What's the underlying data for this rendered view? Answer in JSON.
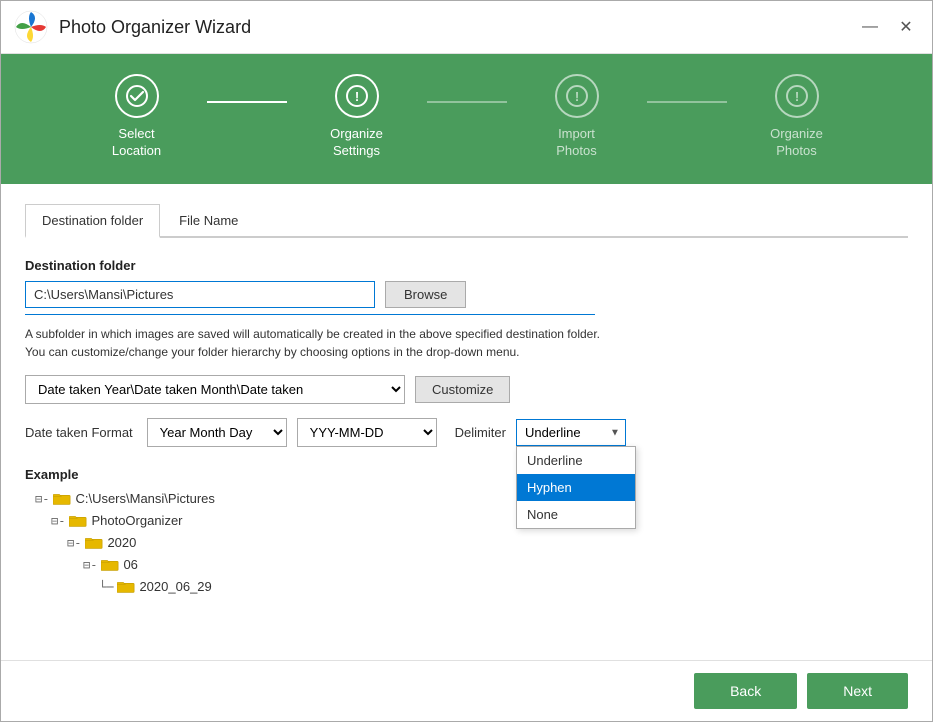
{
  "window": {
    "title": "Photo Organizer Wizard",
    "minimize_btn": "—",
    "close_btn": "✕"
  },
  "steps": [
    {
      "id": "select-location",
      "label": "Select\nLocation",
      "state": "done"
    },
    {
      "id": "organize-settings",
      "label": "Organize\nSettings",
      "state": "active"
    },
    {
      "id": "import-photos",
      "label": "Import\nPhotos",
      "state": "pending"
    },
    {
      "id": "organize-photos",
      "label": "Organize\nPhotos",
      "state": "pending"
    }
  ],
  "tabs": [
    {
      "id": "destination-folder",
      "label": "Destination folder",
      "active": true
    },
    {
      "id": "file-name",
      "label": "File Name",
      "active": false
    }
  ],
  "form": {
    "destination_folder_label": "Destination folder",
    "folder_value": "C:\\Users\\Mansi\\Pictures",
    "browse_label": "Browse",
    "info_line1": "A subfolder in which images are saved will automatically be created in the above specified destination folder.",
    "info_line2": "You can customize/change your folder hierarchy by choosing options in the drop-down menu.",
    "hierarchy_value": "Date taken Year\\Date taken Month\\Date taken",
    "customize_label": "Customize",
    "date_format_label": "Date taken Format",
    "date_format_value": "Year Month Day",
    "date_pattern_value": "YYY-MM-DD",
    "delimiter_label": "Delimiter",
    "delimiter_value": "Underline",
    "delimiter_options": [
      "Underline",
      "Hyphen",
      "None"
    ],
    "delimiter_selected": "Hyphen"
  },
  "example": {
    "label": "Example",
    "tree": [
      {
        "indent": 0,
        "prefix": "⊟-",
        "icon": "folder",
        "text": "C:\\Users\\Mansi\\Pictures"
      },
      {
        "indent": 1,
        "prefix": "⊟-",
        "icon": "folder",
        "text": "PhotoOrganizer"
      },
      {
        "indent": 2,
        "prefix": "⊟-",
        "icon": "folder",
        "text": "2020"
      },
      {
        "indent": 3,
        "prefix": "⊟-",
        "icon": "folder",
        "text": "06"
      },
      {
        "indent": 4,
        "prefix": "└─",
        "icon": "folder",
        "text": "2020_06_29"
      }
    ]
  },
  "footer": {
    "back_label": "Back",
    "next_label": "Next"
  }
}
